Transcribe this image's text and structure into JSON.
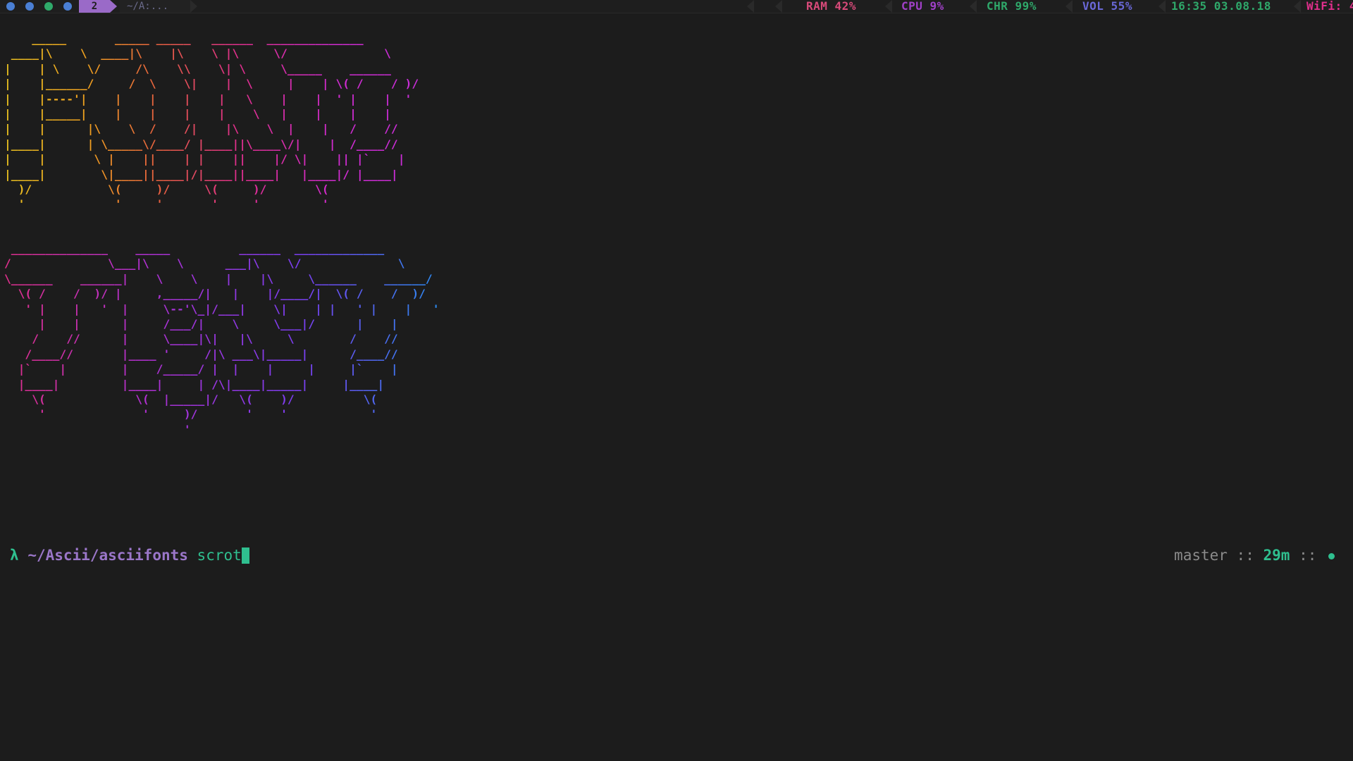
{
  "topbar": {
    "workspace_dots": [
      {
        "color": "#4a7fd4"
      },
      {
        "color": "#4a7fd4"
      },
      {
        "color": "#2faa6a"
      },
      {
        "color": "#4a7fd4"
      }
    ],
    "active_workspace": "2",
    "window_title": "~/A:...",
    "stats": {
      "ram": {
        "label": "RAM",
        "value": "42%"
      },
      "cpu": {
        "label": "CPU",
        "value": "9%"
      },
      "chr": {
        "label": "CHR",
        "value": "99%"
      },
      "vol": {
        "label": "VOL",
        "value": "55%"
      },
      "clock": "16:35 03.08.18",
      "wifi": {
        "label": "WiFi:",
        "value": "4"
      }
    },
    "colors": {
      "ram": "#d84a7a",
      "cpu": "#a040c8",
      "chr": "#2fa86a",
      "vol": "#6a68d8",
      "clock": "#2fa86a",
      "wifi": "#e02f8c",
      "badge": "#9a6ac8"
    }
  },
  "terminal": {
    "art_line_1": [
      "    _____       _____ _____   ______  ______________",
      " ____|\\    \\  ____|\\    |\\    \\ |\\     \\/              \\",
      "|    | \\    \\/     /\\    \\\\    \\| \\     \\_____    ______",
      "|    |______/     /  \\    \\|    |  \\     |    | \\( /    / )/",
      "|    |----'|    |    |    |    |   \\    |    |  ' |    |  '",
      "|    |_____|    |    |    |    |    \\   |    |    |    |",
      "|    |      |\\    \\  /    /|    |\\    \\  |    |   /    //",
      "|____|      | \\_____\\/____/ |____||\\____\\/|    |  /____//",
      "|    |       \\ |    ||    | |    ||    |/ \\|    || |`    |",
      "|____|        \\|____||____|/|____||____|   |____|/ |____|",
      "  )/           \\(     )/     \\(     )/       \\(",
      "  '             '     '       '     '         '"
    ],
    "art_line_2": [
      " ______________    _____          ______  _____________",
      "/              \\___|\\    \\      ___|\\    \\/              \\",
      "\\______    ______|    \\    \\    |    |\\     \\______    ______/",
      "  \\( /    /  )/ |     ,_____/|   |    |/____/|  \\( /    /  )/",
      "   ' |    |   '  |     \\--'\\_|/___|    \\|    | |   ' |    |   '",
      "     |    |      |     /___/|    \\     \\___|/      |    |",
      "    /    //      |     \\____|\\|   |\\     \\        /    //",
      "   /____//       |____ '     /|\\ ___\\|_____|      /____//",
      "  |`    |        |    /_____/ |  |    |     |     |`    |",
      "  |____|         |____|     | /\\|____|_____|     |____|",
      "    \\(             \\(  |_____|/   \\(    )/          \\(",
      "     '              '     )/       '    '            '",
      "                          '"
    ],
    "prompt": {
      "symbol": "λ",
      "cwd": "~/Ascii/asciifonts",
      "command": "scrot"
    },
    "right_prompt": {
      "branch": "master",
      "sep1": " :: ",
      "elapsed": "29m",
      "sep2": " :: "
    }
  }
}
